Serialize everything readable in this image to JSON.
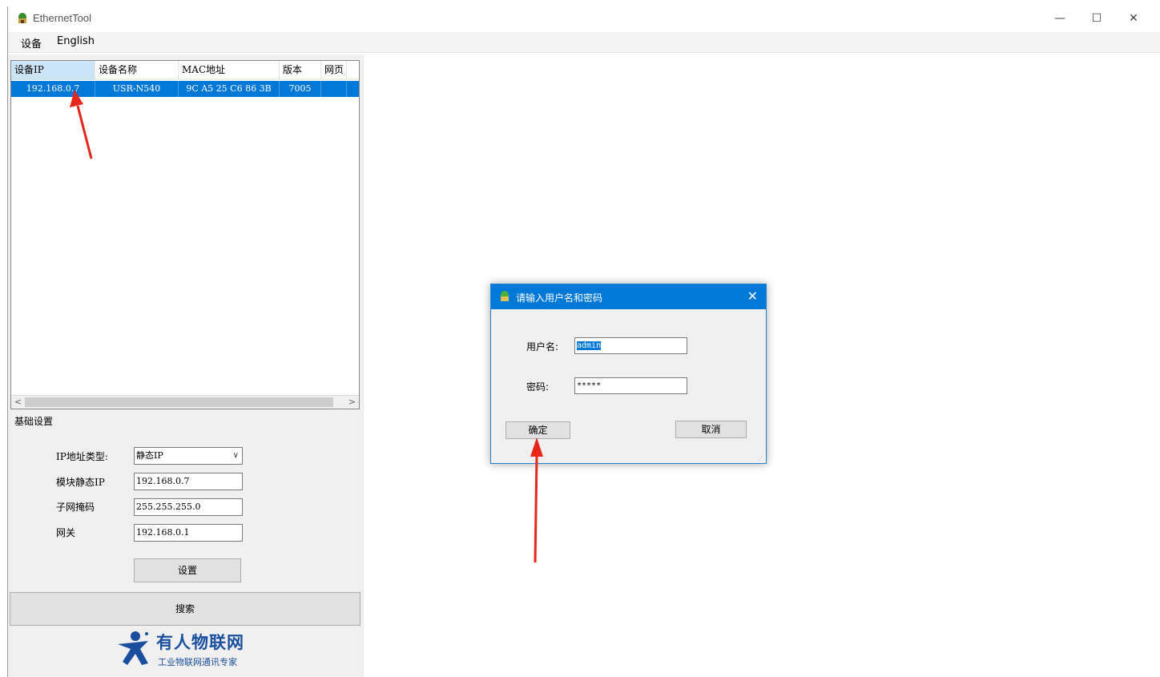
{
  "window": {
    "title": "EthernetTool",
    "minimize": "—",
    "maximize": "☐",
    "close": "✕"
  },
  "menu": {
    "items": [
      "设备",
      "English"
    ]
  },
  "device_list": {
    "columns": [
      "设备IP",
      "设备名称",
      "MAC地址",
      "版本",
      "网页"
    ],
    "rows": [
      {
        "ip": "192.168.0.7",
        "name": "USR-N540",
        "mac": "9C A5 25 C6 86 3B",
        "version": "7005",
        "web": ""
      }
    ],
    "scroll_left": "<",
    "scroll_right": ">"
  },
  "basic_settings": {
    "group_label": "基础设置",
    "ip_type_label": "IP地址类型:",
    "ip_type_value": "静态IP",
    "static_ip_label": "模块静态IP",
    "static_ip_value": "192.168.0.7",
    "subnet_label": "子网掩码",
    "subnet_value": "255.255.255.0",
    "gateway_label": "网关",
    "gateway_value": "192.168.0.1",
    "set_button": "设置"
  },
  "search_button": "搜索",
  "logo": {
    "name": "有人物联网",
    "tagline": "工业物联网通讯专家"
  },
  "login_dialog": {
    "title": "请输入用户名和密码",
    "close": "✕",
    "username_label": "用户名:",
    "username_value": "admin",
    "password_label": "密码:",
    "password_value": "*****",
    "ok_button": "确定",
    "cancel_button": "取消"
  },
  "colors": {
    "selection": "#0078d7",
    "annotation_arrow": "#e8261c",
    "logo_blue": "#1a4f9f"
  }
}
